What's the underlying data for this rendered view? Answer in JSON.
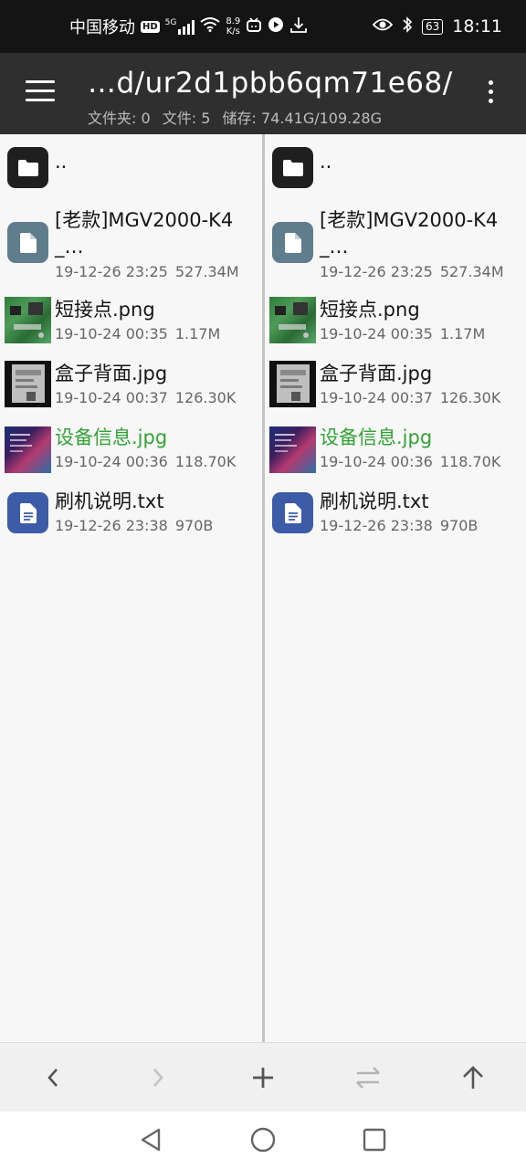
{
  "status_bar": {
    "carrier": "中国移动",
    "hd": "HD",
    "network": "5G",
    "speed_value": "8.9",
    "speed_unit": "K/s",
    "battery": "63",
    "time": "18:11"
  },
  "app_bar": {
    "path": "…d/ur2d1pbb6qm71e68/",
    "folders": "文件夹: 0",
    "files": "文件: 5",
    "storage": "储存: 74.41G/109.28G"
  },
  "parent_label": "..",
  "files": [
    {
      "name": "[老款]MGV2000-K4_…",
      "date": "19-12-26 23:25",
      "size": "527.34M",
      "kind": "file"
    },
    {
      "name": "短接点.png",
      "date": "19-10-24 00:35",
      "size": "1.17M",
      "kind": "image-board"
    },
    {
      "name": "盒子背面.jpg",
      "date": "19-10-24 00:37",
      "size": "126.30K",
      "kind": "image-box"
    },
    {
      "name": "设备信息.jpg",
      "date": "19-10-24 00:36",
      "size": "118.70K",
      "kind": "image-info",
      "selected": true
    },
    {
      "name": "刷机说明.txt",
      "date": "19-12-26 23:38",
      "size": "970B",
      "kind": "text"
    }
  ],
  "colors": {
    "selected_text": "#32a234",
    "folder_icon": "#1f1f1f",
    "file_icon": "#5f7d8c",
    "text_icon": "#3d5ca8"
  },
  "toolbar": [
    "back-icon",
    "forward-icon",
    "add-icon",
    "swap-icon",
    "up-icon"
  ],
  "nav": [
    "back-triangle-icon",
    "home-circle-icon",
    "recents-square-icon"
  ]
}
